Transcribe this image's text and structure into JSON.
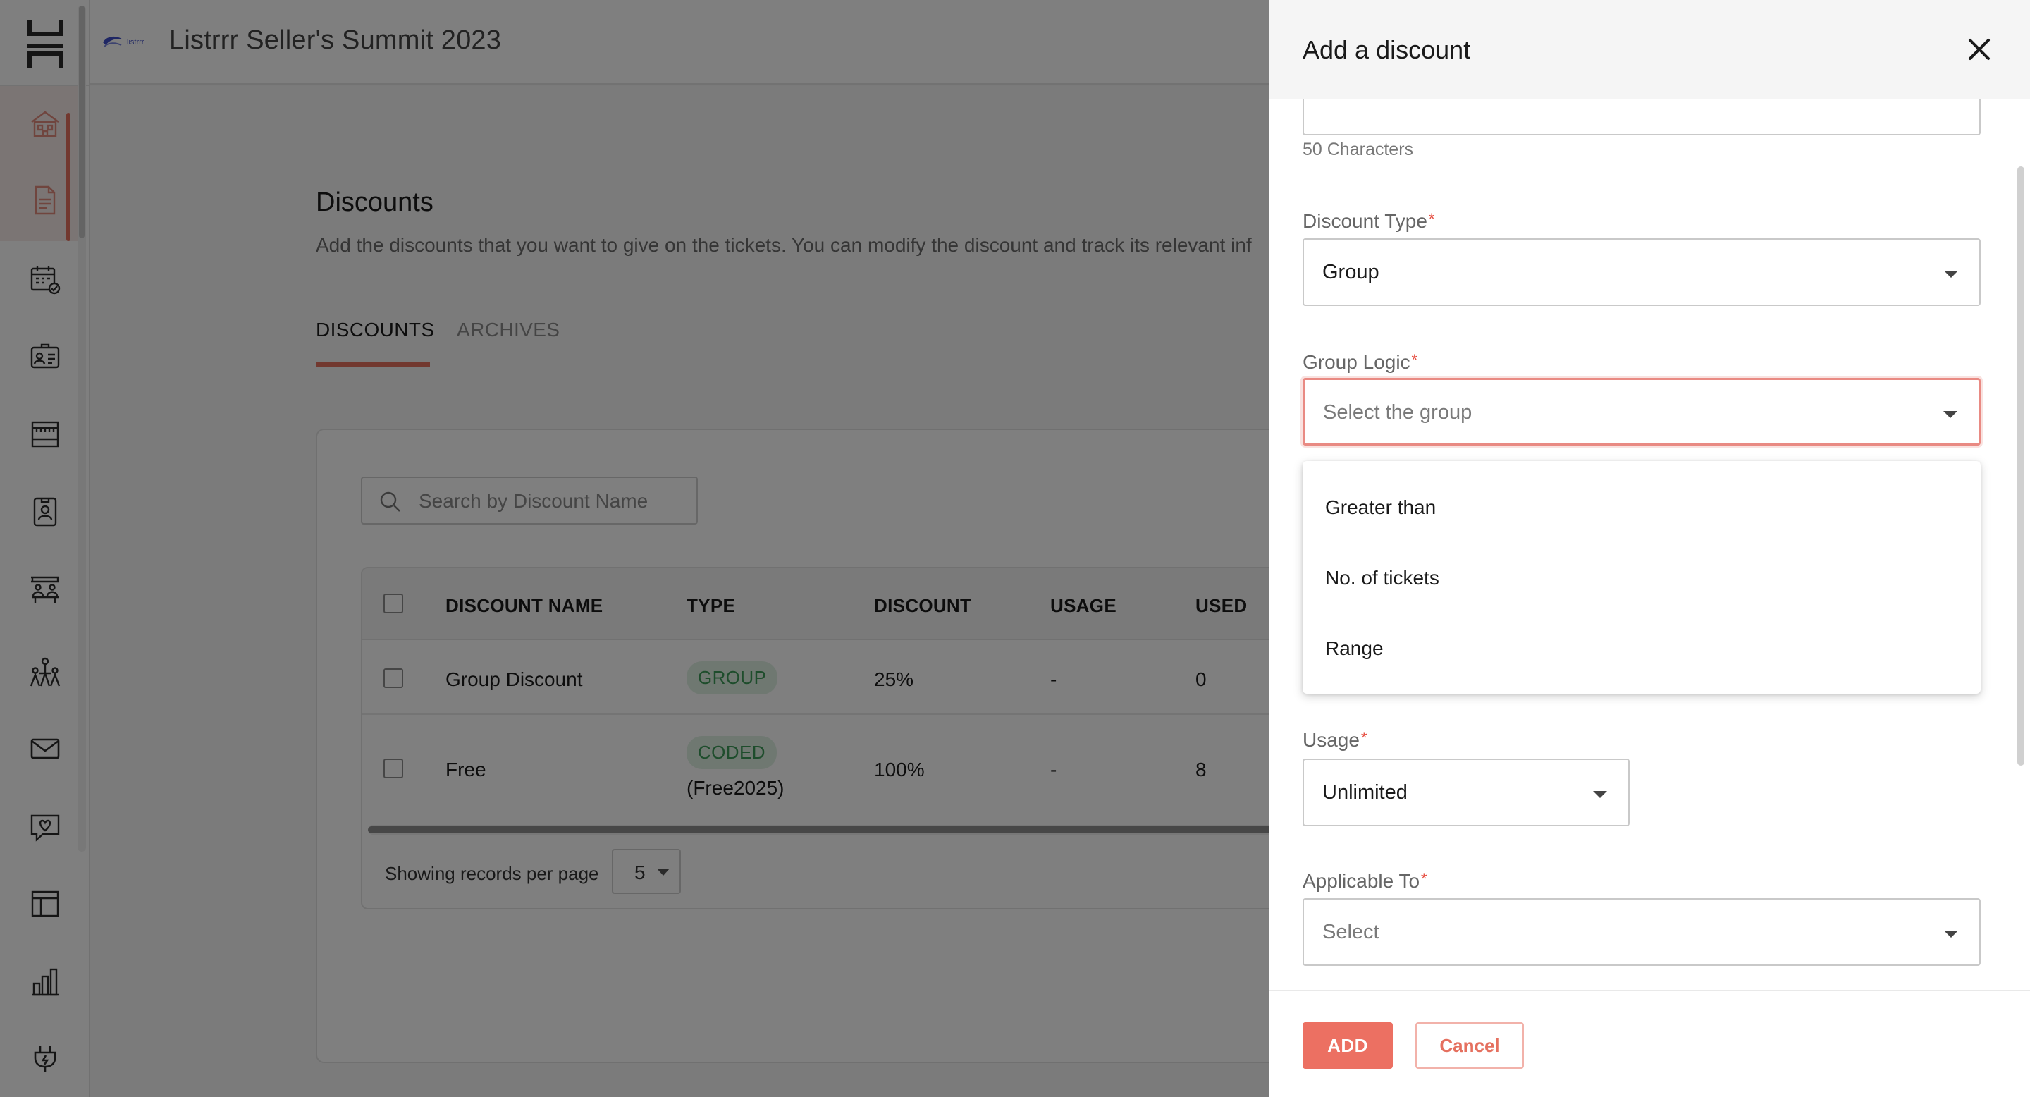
{
  "header": {
    "brand_tiny_text": "listrrr",
    "event_title": "Listrrr Seller's Summit 2023"
  },
  "sidebar": {
    "items": [
      {
        "icon": "venue-icon",
        "active": true
      },
      {
        "icon": "document-icon",
        "active": true
      },
      {
        "icon": "calendar-icon"
      },
      {
        "icon": "attendee-card-icon"
      },
      {
        "icon": "booth-icon"
      },
      {
        "icon": "badge-icon"
      },
      {
        "icon": "seating-icon"
      },
      {
        "icon": "networking-icon"
      },
      {
        "icon": "mail-icon"
      },
      {
        "icon": "chat-heart-icon"
      },
      {
        "icon": "layout-icon"
      },
      {
        "icon": "analytics-icon"
      },
      {
        "icon": "integrations-plug-icon"
      }
    ],
    "accent_color": "#e5705f"
  },
  "page": {
    "title": "Discounts",
    "description": "Add the discounts that you want to give on the tickets. You can modify the discount and track its relevant inf",
    "tabs": [
      {
        "label": "DISCOUNTS",
        "active": true
      },
      {
        "label": "ARCHIVES",
        "active": false
      }
    ]
  },
  "search": {
    "placeholder": "Search by Discount Name",
    "value": ""
  },
  "table": {
    "columns": [
      "DISCOUNT NAME",
      "TYPE",
      "DISCOUNT",
      "USAGE",
      "USED"
    ],
    "rows": [
      {
        "name": "Group Discount",
        "type": "GROUP",
        "type_detail": "",
        "discount": "25%",
        "usage": "-",
        "used": "0"
      },
      {
        "name": "Free",
        "type": "CODED",
        "type_detail": "(Free2025)",
        "discount": "100%",
        "usage": "-",
        "used": "8"
      }
    ],
    "pager_label": "Showing records per page",
    "per_page": "5"
  },
  "drawer": {
    "title": "Add a discount",
    "name_helper": "50 Characters",
    "discount_type": {
      "label": "Discount Type",
      "value": "Group"
    },
    "group_logic": {
      "label": "Group Logic",
      "placeholder": "Select the group",
      "options": [
        "Greater than",
        "No. of tickets",
        "Range"
      ]
    },
    "usage": {
      "label": "Usage",
      "value": "Unlimited"
    },
    "applicable_to": {
      "label": "Applicable To",
      "placeholder": "Select"
    },
    "add_label": "ADD",
    "cancel_label": "Cancel",
    "required_mark": "*"
  },
  "colors": {
    "accent": "#e5705f",
    "badge_bg": "#dff1e3",
    "badge_text": "#3d9a58",
    "focus_border": "#e98a83"
  }
}
